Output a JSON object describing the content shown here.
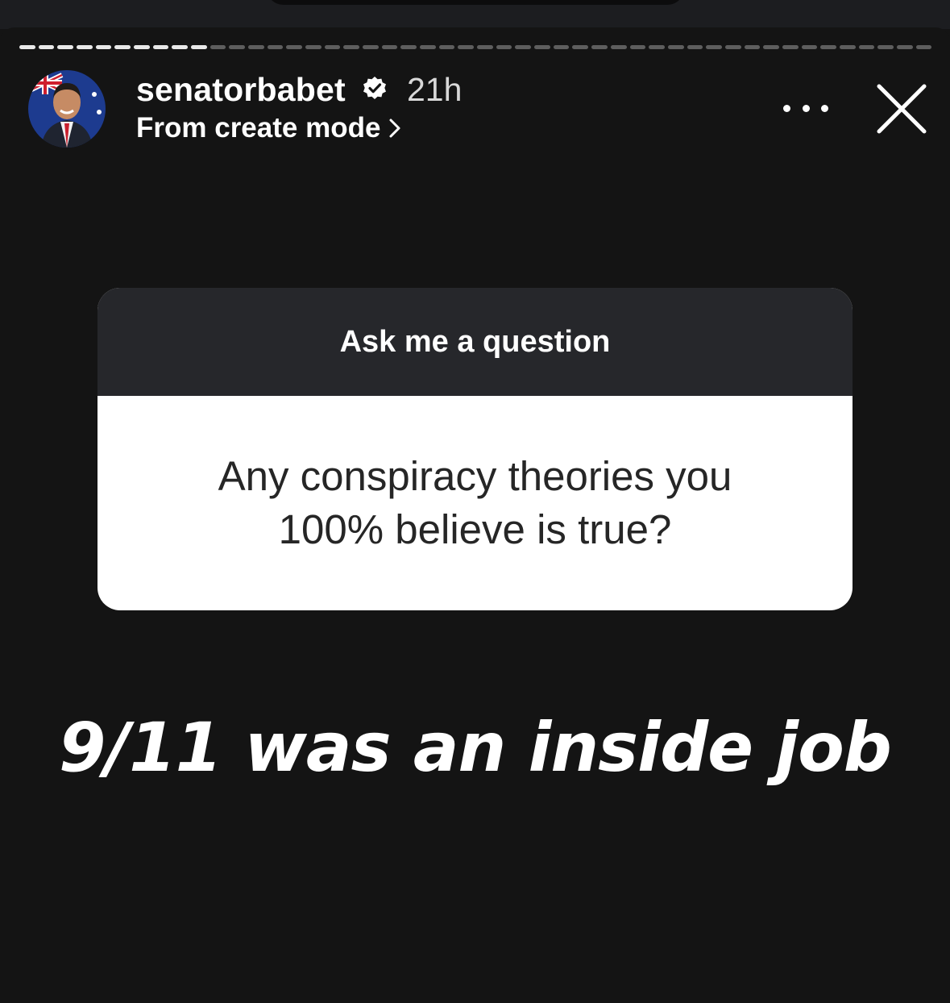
{
  "header": {
    "username": "senatorbabet",
    "timestamp": "21h",
    "subtitle": "From create mode",
    "avatar_icon": "profile-photo-avatar",
    "verified_icon": "verified-badge-icon",
    "more_icon": "more-options-icon",
    "close_icon": "close-icon"
  },
  "progress": {
    "total_segments": 48,
    "completed_segments": 10
  },
  "question_sticker": {
    "title": "Ask me a question",
    "question": "Any conspiracy theories you\n100% believe is true?"
  },
  "answer_text": "9/11 was an inside job",
  "colors": {
    "background": "#141414",
    "sticker_header": "#26272b",
    "sticker_body": "#ffffff",
    "question_text": "#262626",
    "progress_done": "#e9e9e9",
    "progress_pending": "#5e5e5e"
  }
}
